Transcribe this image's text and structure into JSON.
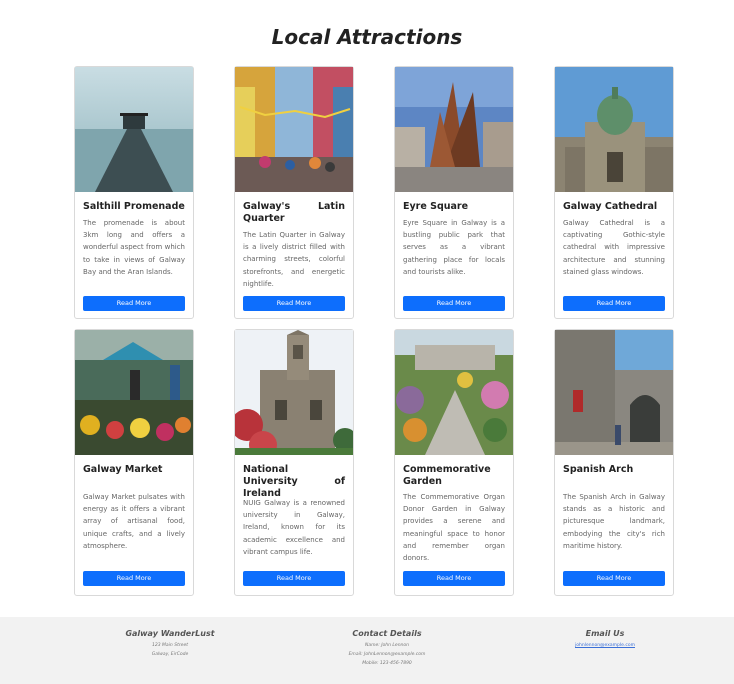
{
  "page": {
    "title": "Local Attractions"
  },
  "cards": [
    {
      "title": "Salthill Promenade",
      "text": "The promenade is about 3km long and offers a wonderful aspect from which to take in views of Galway Bay and the Aran Islands.",
      "button": "Read More"
    },
    {
      "title": "Galway's Latin Quarter",
      "text": "The Latin Quarter in Galway is a lively district filled with charming streets, colorful storefronts, and energetic nightlife.",
      "button": "Read More"
    },
    {
      "title": "Eyre Square",
      "text": "Eyre Square in Galway is a bustling public park that serves as a vibrant gathering place for locals and tourists alike.",
      "button": "Read More"
    },
    {
      "title": "Galway Cathedral",
      "text": "Galway Cathedral is a captivating Gothic-style cathedral with impressive architecture and stunning stained glass windows.",
      "button": "Read More"
    },
    {
      "title": "Galway Market",
      "text": "Galway Market pulsates with energy as it offers a vibrant array of artisanal food, unique crafts, and a lively atmosphere.",
      "button": "Read More"
    },
    {
      "title": "National University of Ireland",
      "text": "NUIG Galway is a renowned university in Galway, Ireland, known for its academic excellence and vibrant campus life.",
      "button": "Read More"
    },
    {
      "title": "Commemorative Garden",
      "text": "The Commemorative Organ Donor Garden in Galway provides a serene and meaningful space to honor and remember organ donors.",
      "button": "Read More"
    },
    {
      "title": "Spanish Arch",
      "text": "The Spanish Arch in Galway stands as a historic and picturesque landmark, embodying the city's rich maritime history.",
      "button": "Read More"
    }
  ],
  "footer": {
    "brand": {
      "heading": "Galway WanderLust",
      "line1": "123 Main Street",
      "line2": "Galway, EirCode"
    },
    "contact": {
      "heading": "Contact Details",
      "line1": "Name: John Lennon",
      "line2": "Email: JohnLennon@example.com",
      "line3": "Mobile: 123-456-7890"
    },
    "email": {
      "heading": "Email Us",
      "link": "johnlennon@example.com"
    }
  },
  "colors": {
    "accent": "#0d6efd",
    "footer_bg": "#f2f2f2"
  }
}
